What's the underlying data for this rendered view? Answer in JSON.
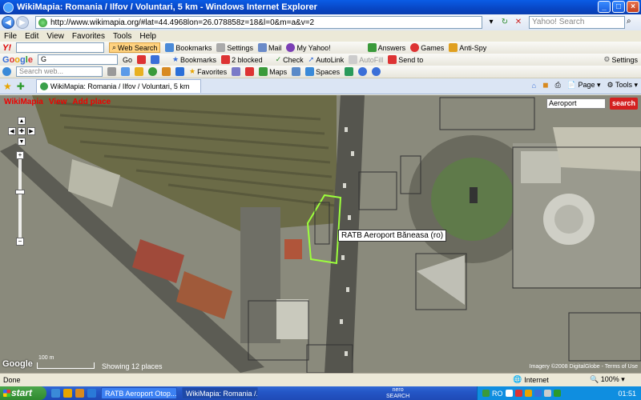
{
  "window": {
    "title": "WikiMapia: Romania / Ilfov / Voluntari, 5 km - Windows Internet Explorer"
  },
  "address": {
    "url": "http://www.wikimapia.org/#lat=44.4968lon=26.078858z=18&l=0&m=a&v=2",
    "search_placeholder": "Yahoo! Search"
  },
  "menu": [
    "File",
    "Edit",
    "View",
    "Favorites",
    "Tools",
    "Help"
  ],
  "yahoo_toolbar": {
    "logo": "Y!",
    "web_search": "Web Search",
    "bookmarks": "Bookmarks",
    "settings": "Settings",
    "mail": "Mail",
    "my_yahoo": "My Yahoo!",
    "answers": "Answers",
    "games": "Games",
    "anti_spy": "Anti-Spy"
  },
  "google_toolbar": {
    "logo": "Google",
    "input_value": "G",
    "go": "Go",
    "bookmarks": "Bookmarks",
    "blocked": "2 blocked",
    "check": "Check",
    "autolink": "AutoLink",
    "autofill": "AutoFill",
    "send_to": "Send to",
    "settings": "Settings"
  },
  "third_toolbar": {
    "search_placeholder": "Search web...",
    "favorites": "Favorites",
    "maps": "Maps",
    "spaces": "Spaces"
  },
  "tabs": {
    "active": "WikiMapia: Romania / Ilfov / Voluntari, 5 km",
    "page": "Page",
    "tools": "Tools"
  },
  "map": {
    "brand": "WikiMapia",
    "view": "View",
    "add_place": "Add place",
    "search_value": "Aeroport",
    "search_btn": "search",
    "place_label": "RATB Aeroport Băneasa (ro)",
    "showing": "Showing 12 places",
    "scale_label": "100 m",
    "copyright": "Imagery ©2008 DigitalGlobe - Terms of Use"
  },
  "status": {
    "left": "Done",
    "zone": "Internet",
    "zoom": "100%"
  },
  "taskbar": {
    "start": "start",
    "task1": "RATB Aeroport Otop...",
    "task2": "WikiMapia: Romania /...",
    "nero_line1": "nero",
    "nero_line2": "SEARCH",
    "lang": "RO",
    "clock": "01:51"
  },
  "colors": {
    "accent": "#0a5ce6",
    "search_red": "#d42020",
    "start_green": "#3c9a3c",
    "highlight": "#9cff3c"
  }
}
